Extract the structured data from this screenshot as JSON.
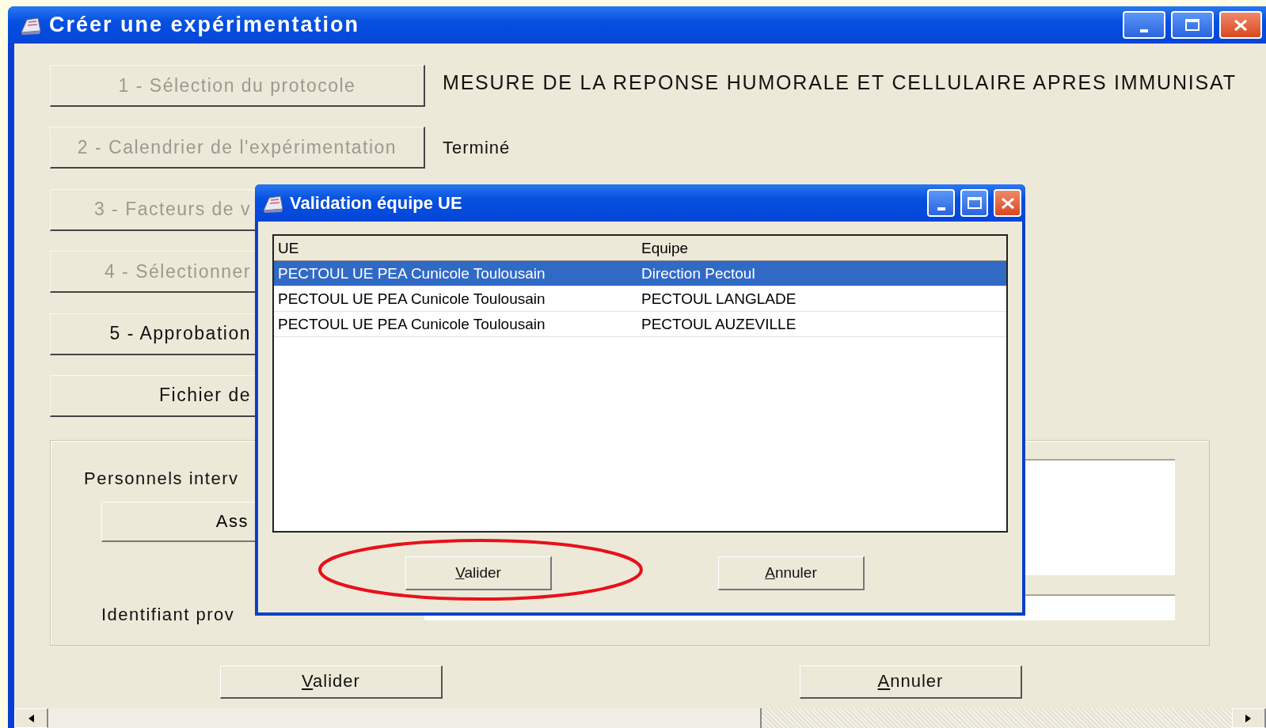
{
  "window": {
    "title": "Créer une expérimentation"
  },
  "steps": [
    {
      "label": "1 - Sélection du protocole",
      "disabled": true,
      "covered": false,
      "info": "MESURE DE LA REPONSE HUMORALE ET CELLULAIRE APRES IMMUNISAT"
    },
    {
      "label": "2 - Calendrier de l'expérimentation",
      "disabled": true,
      "covered": false,
      "info": "Terminé"
    },
    {
      "label": "3 - Facteurs de v",
      "disabled": true,
      "covered": true
    },
    {
      "label": "4 - Sélectionner",
      "disabled": true,
      "covered": true
    },
    {
      "label": "5 - Approbation",
      "disabled": false,
      "covered": true
    },
    {
      "label": "Fichier de",
      "disabled": false,
      "covered": true
    }
  ],
  "personnel_group": {
    "label": "Personnels interv",
    "button": "Ass",
    "id_label": "Identifiant prov"
  },
  "buttons": [
    {
      "accel": "V",
      "rest": "alider"
    },
    {
      "accel": "A",
      "rest": "nnuler"
    }
  ],
  "dialog": {
    "title": "Validation équipe UE",
    "columns": [
      "UE",
      "Equipe"
    ],
    "rows": [
      {
        "cells": [
          "PECTOUL UE PEA Cunicole Toulousain",
          "Direction Pectoul"
        ],
        "selected": true
      },
      {
        "cells": [
          "PECTOUL UE PEA Cunicole Toulousain",
          "PECTOUL LANGLADE"
        ],
        "selected": false
      },
      {
        "cells": [
          "PECTOUL UE PEA Cunicole Toulousain",
          "PECTOUL AUZEVILLE"
        ],
        "selected": false
      }
    ],
    "buttons": [
      {
        "accel": "V",
        "rest": "alider",
        "highlighted": true
      },
      {
        "accel": "A",
        "rest": "nnuler",
        "highlighted": false
      }
    ]
  }
}
